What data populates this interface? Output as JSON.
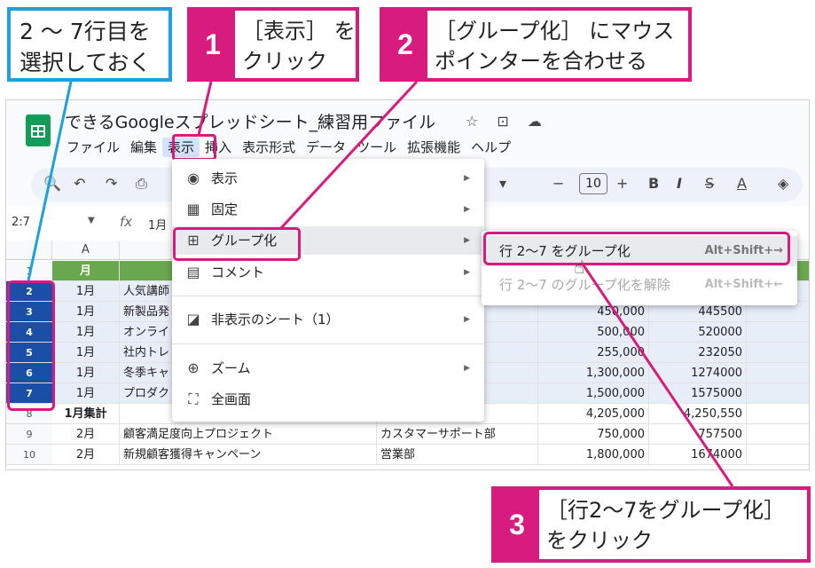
{
  "callouts": {
    "blue_text": [
      "2 ～ 7行目を",
      "選択しておく"
    ],
    "c1": {
      "num": "1",
      "lines": [
        "［表示］ を",
        "クリック"
      ]
    },
    "c2": {
      "num": "2",
      "lines": [
        "［グループ化］ にマウス",
        "ポインターを合わせる"
      ]
    },
    "c3": {
      "num": "3",
      "lines": [
        "［行2～7をグループ化］",
        "をクリック"
      ]
    }
  },
  "app": {
    "title": "できるGoogleスプレッドシート_練習用ファイル",
    "title_icons": "☆ ⊡ ☁",
    "menu": [
      "ファイル",
      "編集",
      "表示",
      "挿入",
      "表示形式",
      "データ",
      "ツール",
      "拡張機能",
      "ヘルプ"
    ],
    "font_size": "10",
    "namebox": "2:7",
    "fx": "fx",
    "formula_value": "1月",
    "col_a": "A"
  },
  "grid": {
    "header": {
      "row": "1",
      "month": "月"
    },
    "rows": [
      {
        "row": "2",
        "month": "1月",
        "name": "人気講師",
        "sel": true,
        "v1": "",
        "v2": ""
      },
      {
        "row": "3",
        "month": "1月",
        "name": "新製品発",
        "sel": true,
        "v1": "450,000",
        "v2": "445500"
      },
      {
        "row": "4",
        "month": "1月",
        "name": "オンライ",
        "sel": true,
        "v1": "500,000",
        "v2": "520000"
      },
      {
        "row": "5",
        "month": "1月",
        "name": "社内トレ",
        "sel": true,
        "v1": "255,000",
        "v2": "232050"
      },
      {
        "row": "6",
        "month": "1月",
        "name": "冬季キャ",
        "sel": true,
        "v1": "1,300,000",
        "v2": "1274000"
      },
      {
        "row": "7",
        "month": "1月",
        "name": "プロダク",
        "sel": true,
        "v1": "1,500,000",
        "v2": "1575000"
      },
      {
        "row": "8",
        "month": "1月集計",
        "name": "",
        "sel": false,
        "v1": "4,205,000",
        "v2": "4,250,550"
      },
      {
        "row": "9",
        "month": "2月",
        "name": "顧客満足度向上プロジェクト",
        "dept": "カスタマーサポート部",
        "sel": false,
        "v1": "750,000",
        "v2": "757500"
      },
      {
        "row": "10",
        "month": "2月",
        "name": "新規顧客獲得キャンペーン",
        "dept": "営業部",
        "sel": false,
        "v1": "1,800,000",
        "v2": "1674000"
      }
    ]
  },
  "view_menu": {
    "items": [
      {
        "icon": "eye-icon",
        "glyph": "◉",
        "label": "表示",
        "arrow": "▶"
      },
      {
        "icon": "freeze-icon",
        "glyph": "▦",
        "label": "固定",
        "arrow": "▶"
      },
      {
        "icon": "group-icon",
        "glyph": "⊞",
        "label": "グループ化",
        "arrow": "▶"
      },
      {
        "icon": "comment-icon",
        "glyph": "▤",
        "label": "コメント",
        "arrow": "▶"
      },
      {
        "icon": "hidden-sheet-icon",
        "glyph": "◪",
        "label": "非表示のシート（1）",
        "arrow": "▶"
      },
      {
        "icon": "zoom-icon",
        "glyph": "⊕",
        "label": "ズーム",
        "arrow": "▶"
      },
      {
        "icon": "fullscreen-icon",
        "glyph": "⛶",
        "label": "全画面",
        "arrow": ""
      }
    ]
  },
  "group_submenu": {
    "items": [
      {
        "label": "行 2～7 をグループ化",
        "shortcut": "Alt+Shift+→",
        "disabled": false
      },
      {
        "label": "行 2～7 のグループ化を解除",
        "shortcut": "Alt+Shift+←",
        "disabled": true
      }
    ]
  },
  "colors": {
    "accent": "#d81b7e",
    "blue": "#1ea0dc",
    "sheets_green": "#0f9d58"
  }
}
